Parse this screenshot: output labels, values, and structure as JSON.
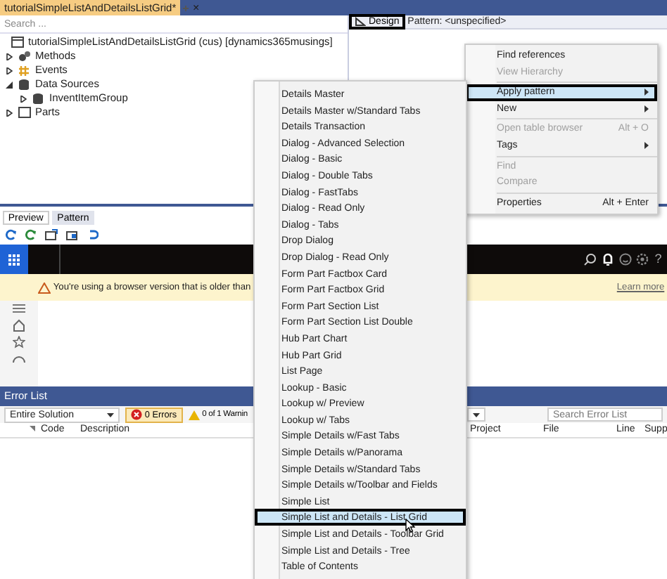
{
  "document_tab": {
    "title": "tutorialSimpleListAndDetailsListGrid*",
    "close": "×"
  },
  "search": {
    "placeholder": "Search ..."
  },
  "tree": {
    "label": "tutorialSimpleListAndDetailsListGrid (cus) [dynamics365musings]",
    "children": [
      {
        "label": "Methods",
        "kind": "methods",
        "expanded": false
      },
      {
        "label": "Events",
        "kind": "events",
        "expanded": false
      },
      {
        "label": "Data Sources",
        "kind": "datasource",
        "expanded": true,
        "children": [
          {
            "label": "InventItemGroup",
            "kind": "datasource",
            "expanded": false
          }
        ]
      },
      {
        "label": "Parts",
        "kind": "parts",
        "expanded": false
      }
    ]
  },
  "designer": {
    "design_button": "Design",
    "pattern": "Pattern: <unspecified>"
  },
  "preview_tabs": [
    {
      "label": "Preview",
      "selected": true
    },
    {
      "label": "Pattern",
      "selected": false
    }
  ],
  "app_bar": {
    "help": "?"
  },
  "warning": {
    "text": "You're using a browser version that is older than",
    "link": "Learn more"
  },
  "error_list": {
    "title": "Error List",
    "scope": "Entire Solution",
    "errors": "0 Errors",
    "warnings": "0 of 1 Warnin",
    "search_placeholder": "Search Error List",
    "columns": [
      "Code",
      "Description",
      "Project",
      "File",
      "Line",
      "Supp"
    ]
  },
  "context_menu": [
    {
      "kind": "item",
      "label": "Find references",
      "disabled": false,
      "selected": false,
      "submenu": false
    },
    {
      "kind": "item",
      "label": "View Hierarchy",
      "disabled": true,
      "selected": false,
      "submenu": false
    },
    {
      "kind": "separator"
    },
    {
      "kind": "item",
      "label": "Apply pattern",
      "disabled": false,
      "selected": true,
      "submenu": true
    },
    {
      "kind": "item",
      "label": "New",
      "disabled": false,
      "selected": false,
      "submenu": true
    },
    {
      "kind": "separator"
    },
    {
      "kind": "item",
      "label": "Open table browser",
      "shortcut": "Alt + O",
      "disabled": true,
      "selected": false,
      "submenu": false
    },
    {
      "kind": "item",
      "label": "Tags",
      "disabled": false,
      "selected": false,
      "submenu": true
    },
    {
      "kind": "separator"
    },
    {
      "kind": "item",
      "label": "Find",
      "disabled": true,
      "selected": false,
      "submenu": false
    },
    {
      "kind": "item",
      "label": "Compare",
      "disabled": true,
      "selected": false,
      "submenu": false
    },
    {
      "kind": "separator"
    },
    {
      "kind": "item",
      "label": "Properties",
      "shortcut": "Alt + Enter",
      "disabled": false,
      "selected": false,
      "submenu": false
    }
  ],
  "pattern_menu": [
    {
      "label": "Details Master",
      "selected": false
    },
    {
      "label": "Details Master w/Standard Tabs",
      "selected": false
    },
    {
      "label": "Details Transaction",
      "selected": false
    },
    {
      "label": "Dialog - Advanced Selection",
      "selected": false
    },
    {
      "label": "Dialog - Basic",
      "selected": false
    },
    {
      "label": "Dialog - Double Tabs",
      "selected": false
    },
    {
      "label": "Dialog - FastTabs",
      "selected": false
    },
    {
      "label": "Dialog - Read Only",
      "selected": false
    },
    {
      "label": "Dialog - Tabs",
      "selected": false
    },
    {
      "label": "Drop Dialog",
      "selected": false
    },
    {
      "label": "Drop Dialog - Read Only",
      "selected": false
    },
    {
      "label": "Form Part Factbox Card",
      "selected": false
    },
    {
      "label": "Form Part Factbox Grid",
      "selected": false
    },
    {
      "label": "Form Part Section List",
      "selected": false
    },
    {
      "label": "Form Part Section List Double",
      "selected": false
    },
    {
      "label": "Hub Part Chart",
      "selected": false
    },
    {
      "label": "Hub Part Grid",
      "selected": false
    },
    {
      "label": "List Page",
      "selected": false
    },
    {
      "label": "Lookup - Basic",
      "selected": false
    },
    {
      "label": "Lookup w/ Preview",
      "selected": false
    },
    {
      "label": "Lookup w/ Tabs",
      "selected": false
    },
    {
      "label": "Simple Details w/Fast Tabs",
      "selected": false
    },
    {
      "label": "Simple Details w/Panorama",
      "selected": false
    },
    {
      "label": "Simple Details w/Standard Tabs",
      "selected": false
    },
    {
      "label": "Simple Details w/Toolbar and Fields",
      "selected": false
    },
    {
      "label": "Simple List",
      "selected": false
    },
    {
      "label": "Simple List and Details - List Grid",
      "selected": true
    },
    {
      "label": "Simple List and Details - Toolbar Grid",
      "selected": false
    },
    {
      "label": "Simple List and Details - Tree",
      "selected": false
    },
    {
      "label": "Table of Contents",
      "selected": false
    }
  ]
}
